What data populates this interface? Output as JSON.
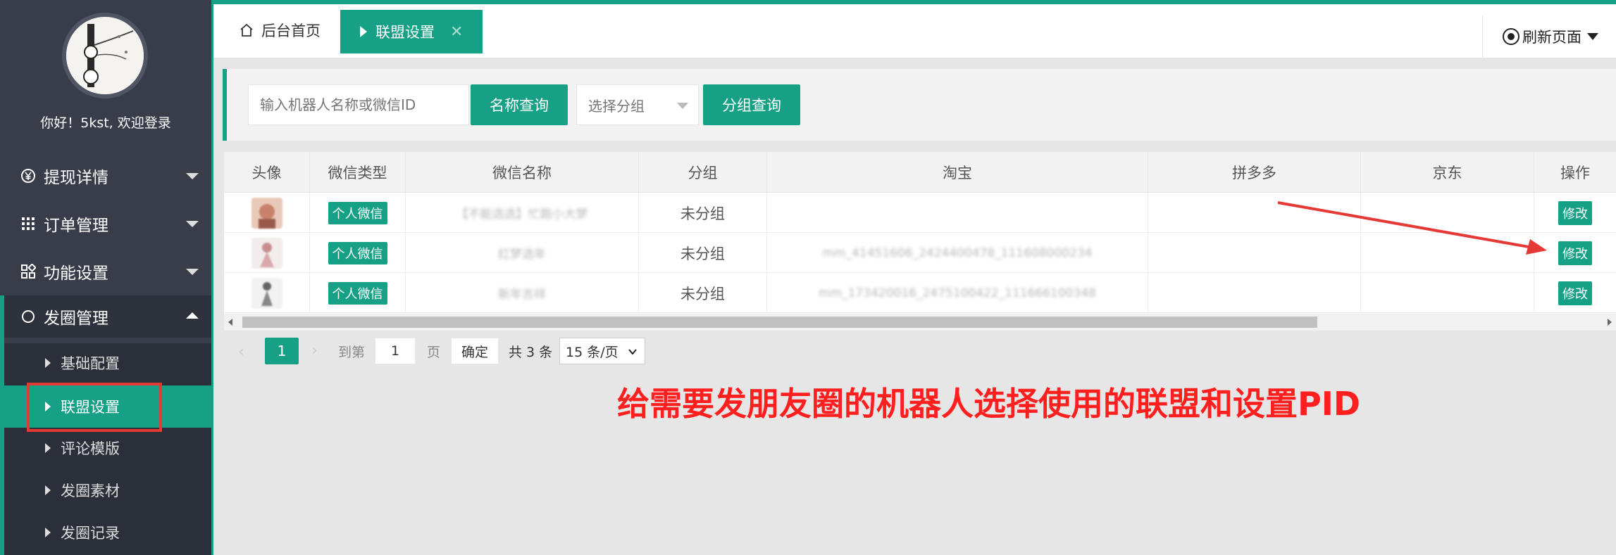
{
  "sidebar": {
    "greeting": "你好！5kst, 欢迎登录",
    "menu": [
      {
        "label": "提现详情",
        "icon": "yen-icon"
      },
      {
        "label": "订单管理",
        "icon": "grid-icon"
      },
      {
        "label": "功能设置",
        "icon": "apps-icon"
      },
      {
        "label": "发圈管理",
        "icon": "circle-icon"
      }
    ],
    "submenu": [
      "基础配置",
      "联盟设置",
      "评论模版",
      "发圈素材",
      "发圈记录"
    ]
  },
  "topbar": {
    "home_tab": "后台首页",
    "active_tab": "联盟设置",
    "refresh": "刷新页面"
  },
  "search": {
    "placeholder": "输入机器人名称或微信ID",
    "name_query_button": "名称查询",
    "group_select": "选择分组",
    "group_query_button": "分组查询"
  },
  "table": {
    "columns": [
      "头像",
      "微信类型",
      "微信名称",
      "分组",
      "淘宝",
      "拼多多",
      "京东",
      "操作"
    ],
    "rows": [
      {
        "type": "个人微信",
        "name": "【不能选选】忙跑小大梦",
        "group": "未分组",
        "taobao": "",
        "pdd": "",
        "jd": "",
        "action": "修改"
      },
      {
        "type": "个人微信",
        "name": "红梦选年",
        "group": "未分组",
        "taobao": "mm_41451606_2424400478_111608000234",
        "pdd": "",
        "jd": "",
        "action": "修改"
      },
      {
        "type": "个人微信",
        "name": "新年吉祥",
        "group": "未分组",
        "taobao": "mm_173420016_2475100422_111666100348",
        "pdd": "",
        "jd": "",
        "action": "修改"
      }
    ]
  },
  "pager": {
    "current": "1",
    "goto_label": "到第",
    "page_input": "1",
    "page_label": "页",
    "confirm": "确定",
    "total": "共 3 条",
    "page_size": "15 条/页"
  },
  "annotation": "给需要发朋友圈的机器人选择使用的联盟和设置PID",
  "colors": {
    "accent": "#16a085",
    "sidebar": "#393d49",
    "annotation": "#ff1f1f"
  }
}
